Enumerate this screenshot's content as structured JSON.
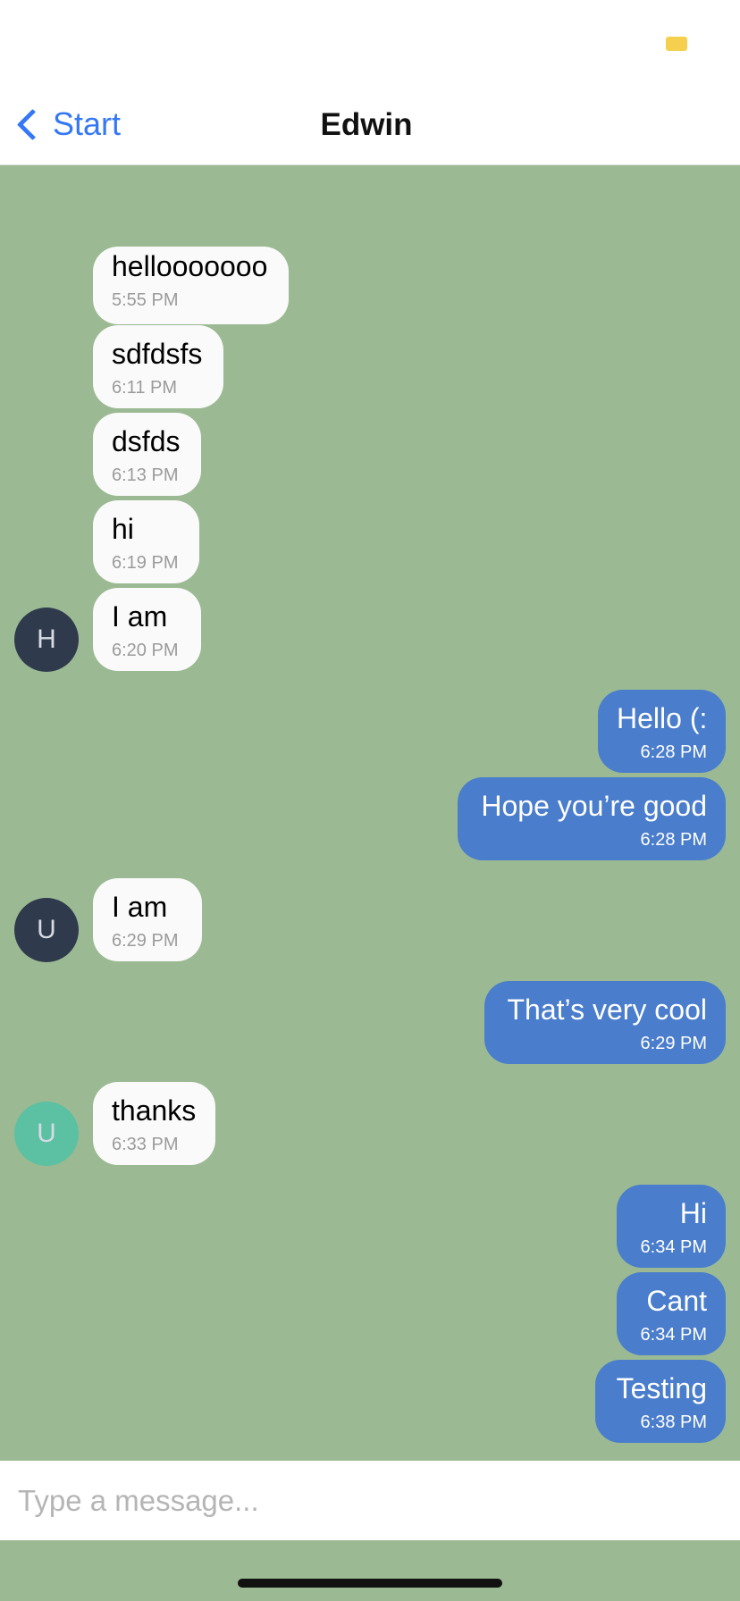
{
  "colors": {
    "accent": "#3478f6",
    "chat_background": "#9bba93",
    "incoming_bubble": "#fafafa",
    "outgoing_bubble": "#4a7dcc",
    "battery": "#f5d04e"
  },
  "nav": {
    "back_label": "Start",
    "title": "Edwin",
    "back_icon": "chevron-left-icon"
  },
  "avatars": {
    "a1": "H",
    "a2": "U",
    "a3": "U"
  },
  "messages": [
    {
      "side": "in",
      "text": "hellooooooo",
      "time": "5:55 PM"
    },
    {
      "side": "in",
      "text": "sdfdsfs",
      "time": "6:11 PM"
    },
    {
      "side": "in",
      "text": "dsfds",
      "time": "6:13 PM"
    },
    {
      "side": "in",
      "text": "hi",
      "time": "6:19 PM"
    },
    {
      "side": "in",
      "text": "I am",
      "time": "6:20 PM"
    },
    {
      "side": "out",
      "text": "Hello (:",
      "time": "6:28 PM"
    },
    {
      "side": "out",
      "text": "Hope you’re good",
      "time": "6:28 PM"
    },
    {
      "side": "in",
      "text": "I am",
      "time": "6:29 PM"
    },
    {
      "side": "out",
      "text": "That’s very cool",
      "time": "6:29 PM"
    },
    {
      "side": "in",
      "text": "thanks",
      "time": "6:33 PM"
    },
    {
      "side": "out",
      "text": "Hi",
      "time": "6:34 PM"
    },
    {
      "side": "out",
      "text": "Cant",
      "time": "6:34 PM"
    },
    {
      "side": "out",
      "text": "Testing",
      "time": "6:38 PM"
    }
  ],
  "composer": {
    "placeholder": "Type a message..."
  }
}
